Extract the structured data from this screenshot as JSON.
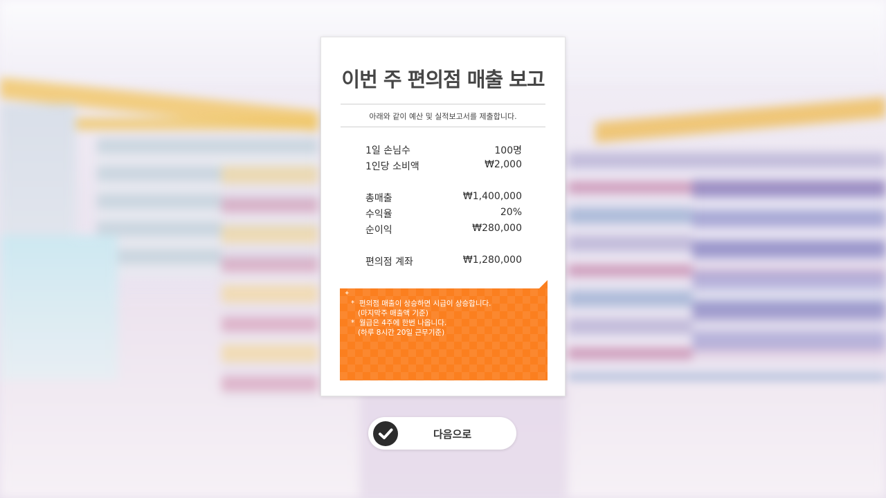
{
  "report": {
    "title": "이번 주 편의점 매출 보고",
    "subtitle": "아래와 같이 예산 및 실적보고서를 제출합니다.",
    "stats": [
      {
        "label": "1일 손님수",
        "value": "100명"
      },
      {
        "label": "1인당 소비액",
        "value": "₩2,000"
      },
      {
        "label": "총매출",
        "value": "₩1,400,000"
      },
      {
        "label": "수익율",
        "value": "20%"
      },
      {
        "label": "순이익",
        "value": "₩280,000"
      },
      {
        "label": "편의점 계좌",
        "value": "₩1,280,000"
      }
    ]
  },
  "notice": {
    "lines": [
      "*  편의점 매출이 상승하면 시급이 상승합니다.",
      "   (마지막주 매출액 기준)",
      "*  월급은 4주에 한번 나옵니다.",
      "   (하루 8시간 20일 근무기준)"
    ],
    "color": "#fb7f1f"
  },
  "next_button": {
    "label": "다음으로",
    "icon": "check-icon"
  }
}
